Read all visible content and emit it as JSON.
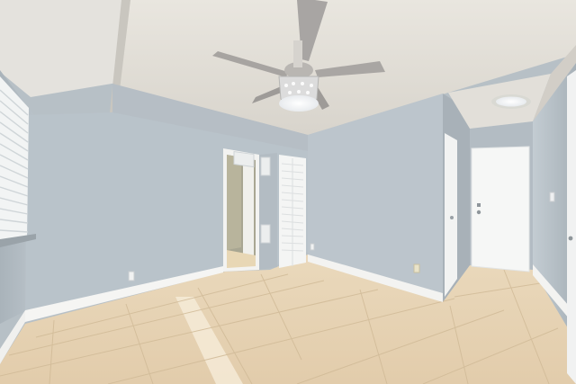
{
  "scene": {
    "description_label": "",
    "colors": {
      "wall": "#b9c3ca",
      "wall_shadow": "#9aa4ac",
      "ceiling": "#eceae4",
      "ceiling_dark": "#cfcbc4",
      "floor": "#e6d2b3",
      "floor_light": "#f1e3cb",
      "baseboard": "#f7f7f5",
      "door": "#f4f5f4",
      "blinds": "#eef0f0"
    },
    "objects": [
      "ceiling-fan",
      "fan-light-fixture",
      "window-blinds",
      "open-doorway",
      "louvered-closet-door",
      "interior-door",
      "entry-door",
      "hallway-ceiling-light",
      "tile-floor",
      "air-vent",
      "wall-outlet"
    ]
  }
}
